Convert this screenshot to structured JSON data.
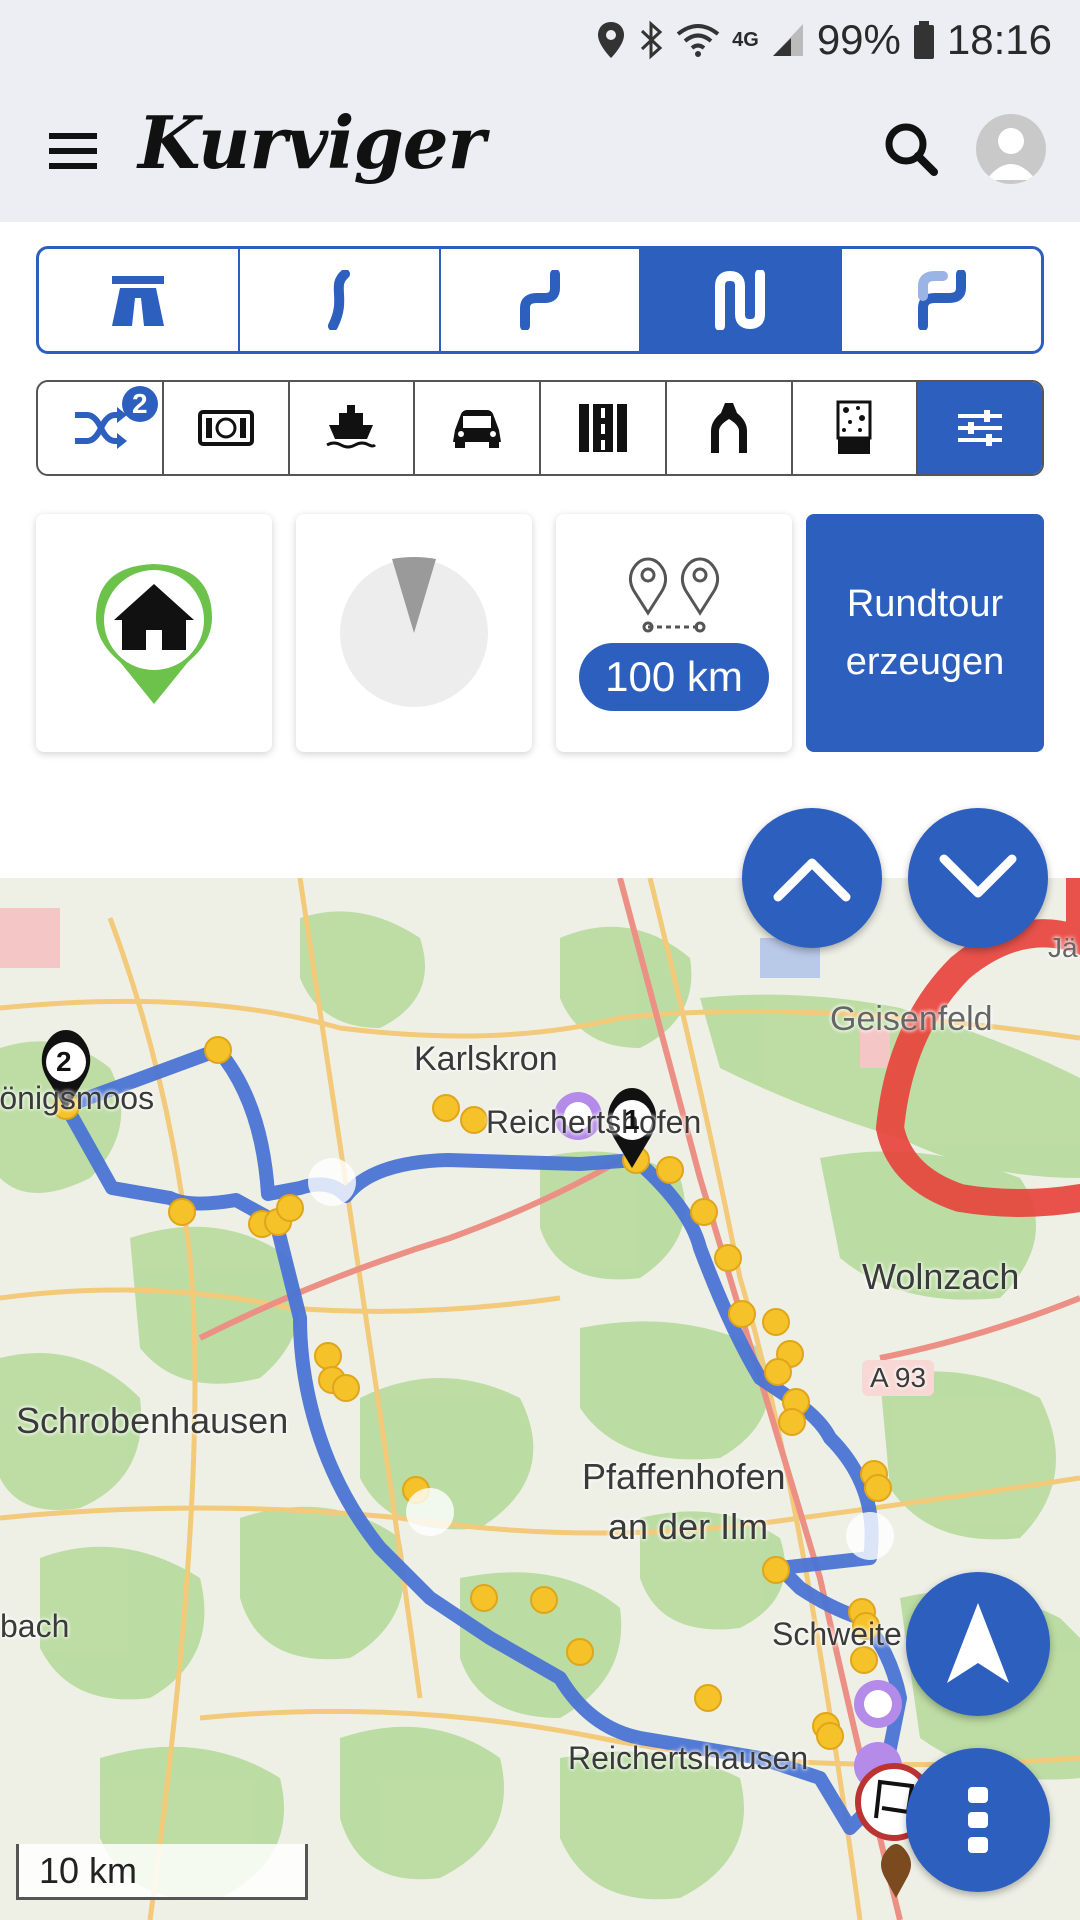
{
  "status_bar": {
    "battery": "99%",
    "time": "18:16",
    "network": "4G"
  },
  "app": {
    "logo_text": "Kurviger"
  },
  "route_styles": [
    "motorway",
    "curvy",
    "extra-curvy",
    "super-curvy",
    "curvy-variant"
  ],
  "route_styles_active_index": 3,
  "options": {
    "shuffle_badge": "2"
  },
  "cards": {
    "distance": "100 km",
    "generate_label": "Rundtour erzeugen"
  },
  "map": {
    "labels": {
      "karlskron": "Karlskron",
      "reichertshofen": "Reichertshofen",
      "koenigsmoos": "Königsmoos",
      "wolnzach": "Wolnzach",
      "a93": "A 93",
      "schrobenhausen": "Schrobenhausen",
      "pfaffenhofen_1": "Pfaffenhofen",
      "pfaffenhofen_2": "an der Ilm",
      "schweitenkirchen": "Schweitenkirchen",
      "reichertshausen": "Reichertshausen",
      "bach": "bach",
      "geisenfeld": "Geisenfeld",
      "jae": "Jä"
    },
    "markers": {
      "via1": "1",
      "via2": "2"
    },
    "scale": "10 km"
  },
  "colors": {
    "accent": "#2d5fbf",
    "route": "#4a74d4",
    "annotation": "#e8403a",
    "poi_yellow": "#f6c22a"
  }
}
